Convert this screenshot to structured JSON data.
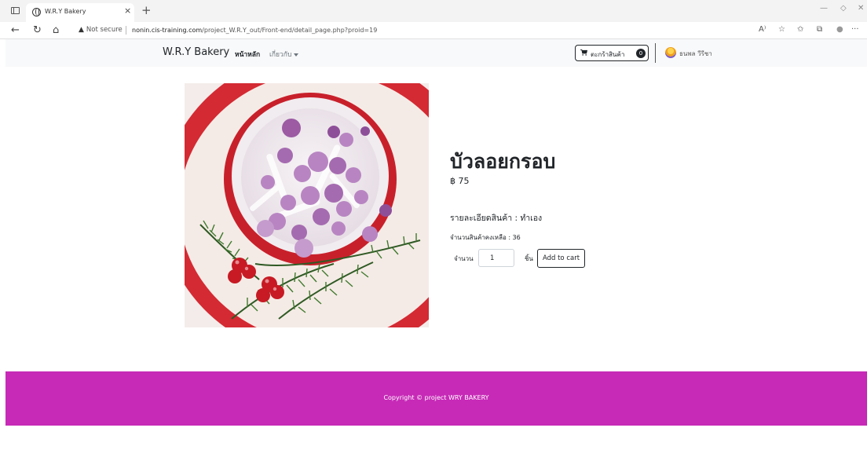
{
  "browser": {
    "tab_title": "W.R.Y Bakery",
    "tab_close": "×",
    "new_tab": "+",
    "security_label": "Not secure",
    "url_host": "nonin.cis-training.com",
    "url_path": "/project_W.R.Y_out/Front-end/detail_page.php?proid=19",
    "toolbar_icons": [
      "read-aloud-icon",
      "favorite-add-icon",
      "favorites-icon",
      "collections-icon",
      "profile-icon",
      "more-icon"
    ],
    "toolbar_glyphs": [
      "A⁾",
      "☆",
      "✩",
      "⧉",
      "●",
      "···"
    ]
  },
  "navbar": {
    "brand": "W.R.Y Bakery",
    "home_link": "หน้าหลัก",
    "about_link": "เกี่ยวกับ",
    "cart_label": "ตะกร้าสินค้า",
    "cart_count": "0",
    "user_name": "ธนพล วีรีชา"
  },
  "product": {
    "name": "บัวลอยกรอบ",
    "price": "฿ 75",
    "detail": "รายละเอียดสินค้า : ทำเอง",
    "stock": "จำนวนสินค้าคงเหลือ : 36",
    "qty_label": "จำนวน",
    "qty_value": "1",
    "unit_label": "ชิ้น",
    "add_button": "Add to cart"
  },
  "footer": {
    "copyright": "Copyright © project WRY BAKERY"
  },
  "colors": {
    "footer_bg": "#c72ab7",
    "navbar_bg": "#f8f9fa"
  }
}
